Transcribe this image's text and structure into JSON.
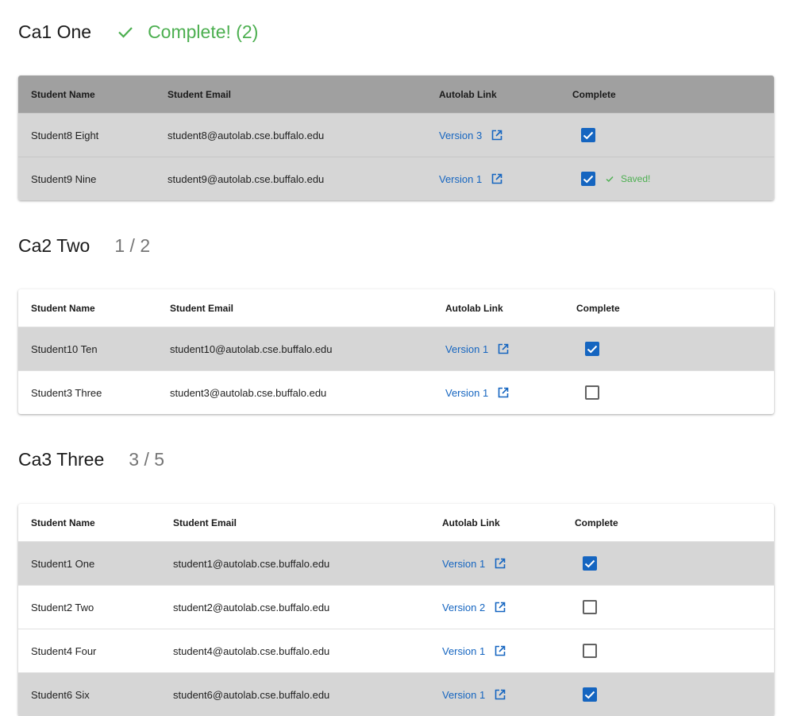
{
  "columns": {
    "name": "Student Name",
    "email": "Student Email",
    "link": "Autolab Link",
    "complete": "Complete"
  },
  "sections": [
    {
      "title": "Ca1 One",
      "status": "Complete! (2)",
      "rows": [
        {
          "name": "Student8 Eight",
          "email": "student8@autolab.cse.buffalo.edu",
          "link": "Version 3",
          "complete": true,
          "note": ""
        },
        {
          "name": "Student9 Nine",
          "email": "student9@autolab.cse.buffalo.edu",
          "link": "Version 1",
          "complete": true,
          "note": "Saved!"
        }
      ]
    },
    {
      "title": "Ca2 Two",
      "status": "1 / 2",
      "rows": [
        {
          "name": "Student10 Ten",
          "email": "student10@autolab.cse.buffalo.edu",
          "link": "Version 1",
          "complete": true
        },
        {
          "name": "Student3 Three",
          "email": "student3@autolab.cse.buffalo.edu",
          "link": "Version 1",
          "complete": false
        }
      ]
    },
    {
      "title": "Ca3 Three",
      "status": "3 / 5",
      "rows": [
        {
          "name": "Student1 One",
          "email": "student1@autolab.cse.buffalo.edu",
          "link": "Version 1",
          "complete": true
        },
        {
          "name": "Student2 Two",
          "email": "student2@autolab.cse.buffalo.edu",
          "link": "Version 2",
          "complete": false
        },
        {
          "name": "Student4 Four",
          "email": "student4@autolab.cse.buffalo.edu",
          "link": "Version 1",
          "complete": false
        },
        {
          "name": "Student6 Six",
          "email": "student6@autolab.cse.buffalo.edu",
          "link": "Version 1",
          "complete": true
        }
      ]
    }
  ],
  "colors": {
    "accent": "#1565c0",
    "success": "#4caf50",
    "muted": "#757575",
    "shaded_row": "#d6d6d6",
    "completed_header": "#a0a0a0"
  },
  "icons": {
    "status_complete": "check-icon",
    "link": "open-in-new-icon",
    "saved": "check-icon"
  }
}
